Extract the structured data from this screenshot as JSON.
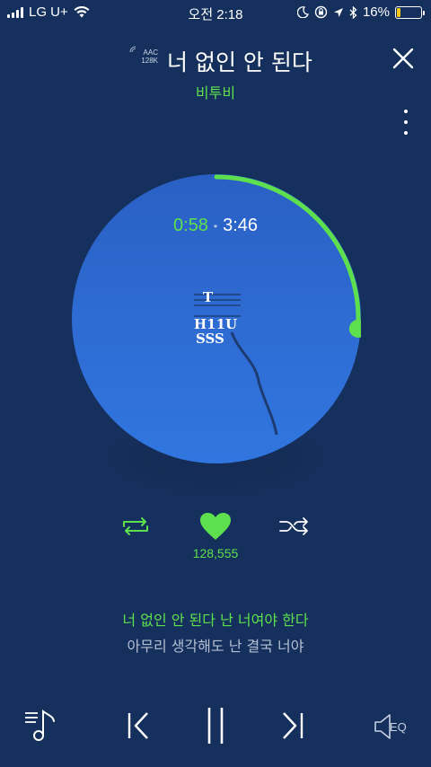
{
  "status_bar": {
    "carrier": "LG U+",
    "time": "오전 2:18",
    "battery_text": "16%",
    "battery_level": 0.16,
    "icons": [
      "signal-icon",
      "wifi-icon",
      "moon-icon",
      "rotation-lock-icon",
      "location-icon",
      "bluetooth-icon",
      "battery-icon"
    ]
  },
  "header": {
    "codec": "AAC",
    "bitrate": "128K",
    "title": "너 없인 안 된다",
    "artist": "비투비"
  },
  "player": {
    "elapsed": "0:58",
    "separator": "•",
    "total": "3:46",
    "progress": 0.257,
    "album_art_text_lines": [
      "T",
      "H11U",
      "SSS"
    ],
    "colors": {
      "accent": "#5ee04e",
      "background": "#15305c",
      "disc": "#2f6fd8"
    }
  },
  "actions": {
    "repeat_icon": "repeat-icon",
    "like_icon": "heart-icon",
    "like_count": "128,555",
    "shuffle_icon": "shuffle-icon"
  },
  "lyrics": {
    "current": "너 없인 안 된다 난 너여야 한다",
    "next": "아무리 생각해도 난 결국 너야"
  },
  "bottom_bar": {
    "playlist_icon": "playlist-icon",
    "prev_icon": "previous-icon",
    "pause_icon": "pause-icon",
    "next_icon": "next-icon",
    "eq_label": "EQ"
  }
}
